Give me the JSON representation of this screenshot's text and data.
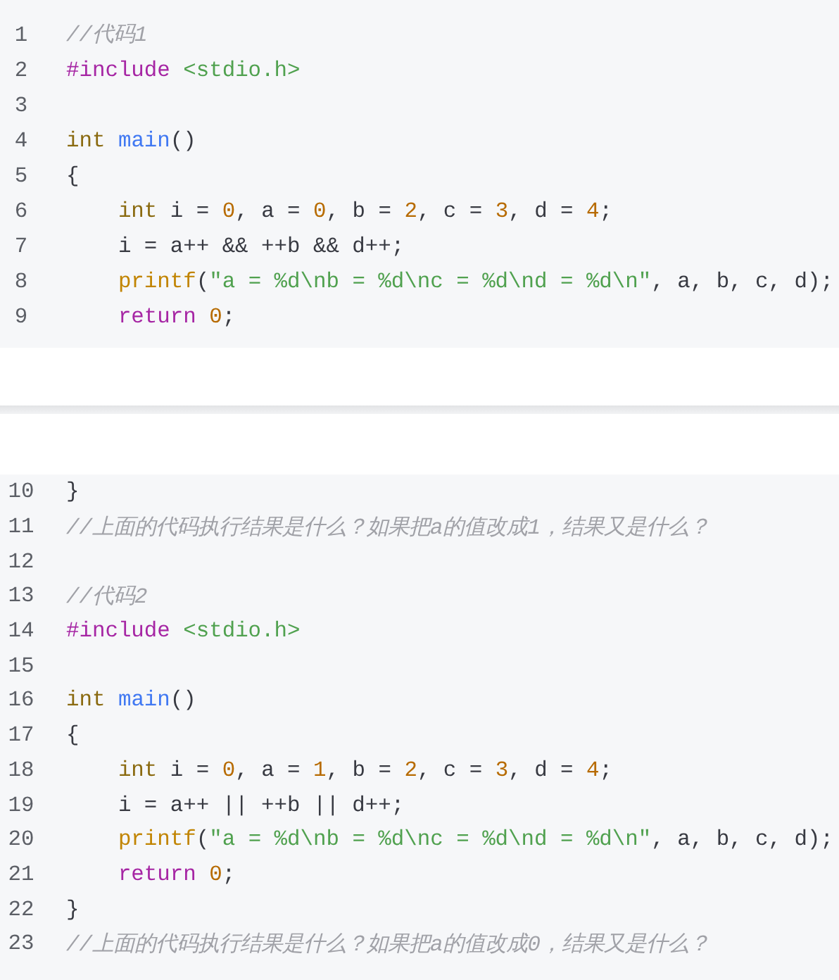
{
  "code_blocks": [
    {
      "lines": [
        {
          "number": "1",
          "tokens": [
            {
              "kind": "comment",
              "text": "//代码1"
            }
          ]
        },
        {
          "number": "2",
          "tokens": [
            {
              "kind": "keyword",
              "text": "#include"
            },
            {
              "kind": "string",
              "text": " <stdio.h>"
            }
          ]
        },
        {
          "number": "3"
        },
        {
          "number": "4",
          "tokens": [
            {
              "kind": "type",
              "text": "int"
            },
            {
              "kind": "function",
              "text": " main"
            },
            {
              "kind": "plain",
              "text": "()"
            }
          ]
        },
        {
          "number": "5",
          "tokens": [
            {
              "kind": "plain",
              "text": "{"
            }
          ],
          "children": [
            {
              "number": "6",
              "tokens": [
                {
                  "kind": "type",
                  "text": "int"
                },
                {
                  "kind": "plain",
                  "text": " i = "
                },
                {
                  "kind": "number",
                  "text": "0"
                },
                {
                  "kind": "plain",
                  "text": ", a = "
                },
                {
                  "kind": "number",
                  "text": "0"
                },
                {
                  "kind": "plain",
                  "text": ", b = "
                },
                {
                  "kind": "number",
                  "text": "2"
                },
                {
                  "kind": "plain",
                  "text": ", c = "
                },
                {
                  "kind": "number",
                  "text": "3"
                },
                {
                  "kind": "plain",
                  "text": ", d = "
                },
                {
                  "kind": "number",
                  "text": "4"
                },
                {
                  "kind": "plain",
                  "text": ";"
                }
              ]
            },
            {
              "number": "7",
              "tokens": [
                {
                  "kind": "plain",
                  "text": "i = a++ && ++b && d++;"
                }
              ]
            },
            {
              "number": "8",
              "tokens": [
                {
                  "kind": "builtin",
                  "text": "printf"
                },
                {
                  "kind": "plain",
                  "text": "("
                },
                {
                  "kind": "string",
                  "text": "\"a = %d\\nb = %d\\nc = %d\\nd = %d\\n\""
                },
                {
                  "kind": "plain",
                  "text": ", a, b, c, d);"
                }
              ]
            },
            {
              "number": "9",
              "tokens": [
                {
                  "kind": "keyword",
                  "text": "return"
                },
                {
                  "kind": "number",
                  "text": " 0"
                },
                {
                  "kind": "plain",
                  "text": ";"
                }
              ]
            }
          ]
        }
      ]
    },
    {
      "lines": [
        {
          "number": "10",
          "tokens": [
            {
              "kind": "plain",
              "text": "}"
            }
          ]
        },
        {
          "number": "11",
          "tokens": [
            {
              "kind": "comment",
              "text": "//上面的代码执行结果是什么？如果把a的值改成1，结果又是什么？"
            }
          ]
        },
        {
          "number": "12"
        },
        {
          "number": "13",
          "tokens": [
            {
              "kind": "comment",
              "text": "//代码2"
            }
          ]
        },
        {
          "number": "14",
          "tokens": [
            {
              "kind": "keyword",
              "text": "#include"
            },
            {
              "kind": "string",
              "text": " <stdio.h>"
            }
          ]
        },
        {
          "number": "15"
        },
        {
          "number": "16",
          "tokens": [
            {
              "kind": "type",
              "text": "int"
            },
            {
              "kind": "function",
              "text": " main"
            },
            {
              "kind": "plain",
              "text": "()"
            }
          ]
        },
        {
          "number": "17",
          "tokens": [
            {
              "kind": "plain",
              "text": "{"
            }
          ],
          "children": [
            {
              "number": "18",
              "tokens": [
                {
                  "kind": "type",
                  "text": "int"
                },
                {
                  "kind": "plain",
                  "text": " i = "
                },
                {
                  "kind": "number",
                  "text": "0"
                },
                {
                  "kind": "plain",
                  "text": ", a = "
                },
                {
                  "kind": "number",
                  "text": "1"
                },
                {
                  "kind": "plain",
                  "text": ", b = "
                },
                {
                  "kind": "number",
                  "text": "2"
                },
                {
                  "kind": "plain",
                  "text": ", c = "
                },
                {
                  "kind": "number",
                  "text": "3"
                },
                {
                  "kind": "plain",
                  "text": ", d = "
                },
                {
                  "kind": "number",
                  "text": "4"
                },
                {
                  "kind": "plain",
                  "text": ";"
                }
              ]
            },
            {
              "number": "19",
              "tokens": [
                {
                  "kind": "plain",
                  "text": "i = a++ || ++b || d++;"
                }
              ]
            },
            {
              "number": "20",
              "tokens": [
                {
                  "kind": "builtin",
                  "text": "printf"
                },
                {
                  "kind": "plain",
                  "text": "("
                },
                {
                  "kind": "string",
                  "text": "\"a = %d\\nb = %d\\nc = %d\\nd = %d\\n\""
                },
                {
                  "kind": "plain",
                  "text": ", a, b, c, d);"
                }
              ]
            },
            {
              "number": "21",
              "tokens": [
                {
                  "kind": "keyword",
                  "text": "return"
                },
                {
                  "kind": "number",
                  "text": " 0"
                },
                {
                  "kind": "plain",
                  "text": ";"
                }
              ]
            }
          ]
        },
        {
          "number": "22",
          "tokens": [
            {
              "kind": "plain",
              "text": "}"
            }
          ]
        },
        {
          "number": "23",
          "tokens": [
            {
              "kind": "comment",
              "text": "//上面的代码执行结果是什么？如果把a的值改成0，结果又是什么？"
            }
          ]
        }
      ]
    }
  ]
}
